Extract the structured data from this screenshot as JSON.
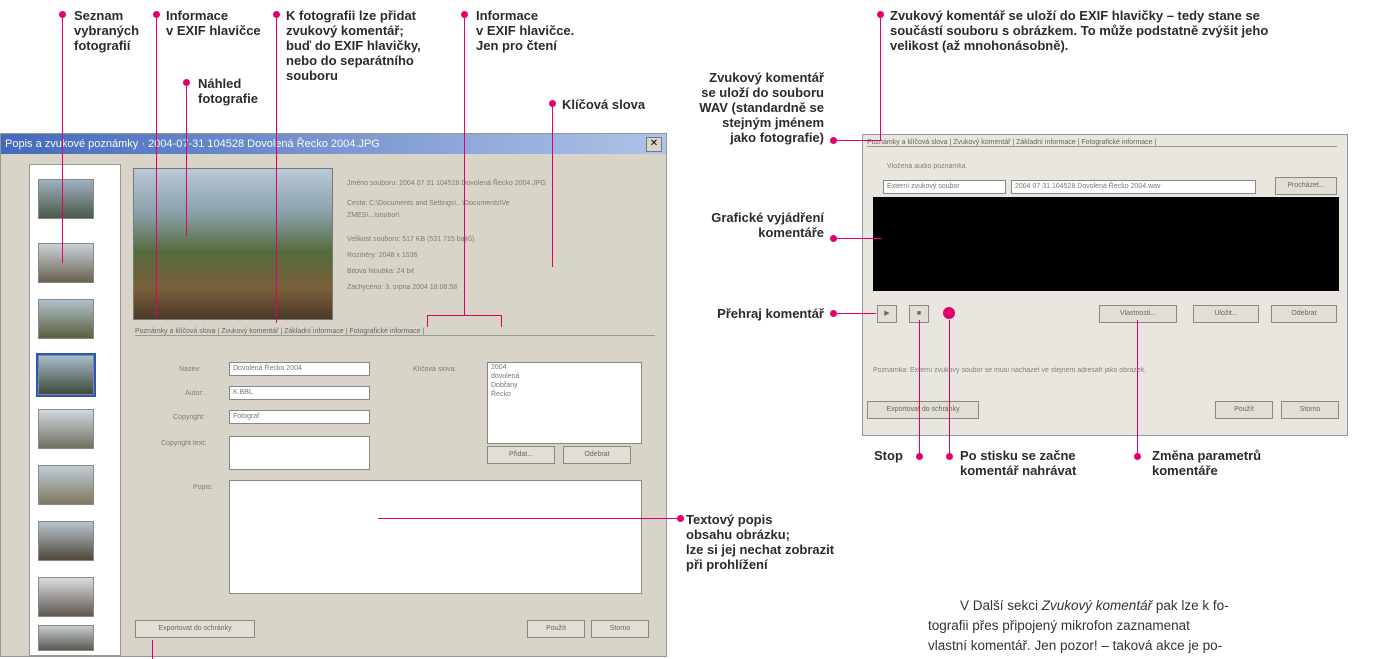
{
  "annotations": {
    "seznam": "Seznam\nvybraných\nfotografií",
    "exif_info": "Informace\nv EXIF hlavičce",
    "nahled": "Náhled\nfotografie",
    "zvukovy_pridat": "K fotografii lze přidat\nzvukový komentář;\nbuď do EXIF hlavičky,\nnebo do separátního\nsouboru",
    "exif_readonly": "Informace\nv EXIF hlavičce.\nJen pro čtení",
    "klicova_slova": "Klíčová slova",
    "textovy_popis": "Textový popis\nobsahu obrázku;\nlze si jej nechat zobrazit\npři prohlížení",
    "zvukovy_exif": "Zvukový komentář se uloží do EXIF hlavičky – tedy stane se\nsoučástí souboru s obrázkem. To může podstatně zvýšit jeho\nvelikost (až mnohonásobně).",
    "zvukovy_wav": "Zvukový komentář\nse uloží do souboru\nWAV (standardně se\nstejným jménem\njako fotografie)",
    "graficke": "Grafické vyjádření\nkomentáře",
    "prehraj": "Přehraj komentář",
    "stop": "Stop",
    "po_stisku": "Po stisku se začne\nkomentář nahrávat",
    "zmena": "Změna parametrů\nkomentáře"
  },
  "left_dialog": {
    "title": "Popis a zvukové poznámky · 2004-07-31 104528 Dovolená Řecko 2004.JPG",
    "close": "✕",
    "info_lines": [
      "Jméno souboru:   2004 07 31 104528 Dovolená Řecko 2004.JPG",
      "Cesta:   C:\\Documents and Settings\\...\\Documents\\Ve",
      "          ZMES\\...\\soubor\\",
      "Velikost souboru:   517 KB (531 715 bajtů)",
      "Rozměry:   2048 x 1536",
      "Bitová hloubka:   24 bit",
      "Zachyceno:   3. srpna 2004 18:08:58"
    ],
    "tabs": "Poznámky a klíčová slova | Zvukový komentář | Základní informace | Fotografické informace |",
    "labels": {
      "nazev": "Název:",
      "autor": "Autor:",
      "copyright": "Copyright:",
      "copyright_text": "Copyright text:",
      "popis": "Popis:",
      "klicova": "Klíčová slova:"
    },
    "values": {
      "nazev": "Dovolená Řecko 2004",
      "autor": "K.BBL",
      "copyright": "Fotograf"
    },
    "keywords": [
      "2004",
      "dovolená",
      "Dobřany",
      "Řecko"
    ],
    "btn_pridat": "Přidat...",
    "btn_odebrat": "Odebrat",
    "btn_export": "Exportovat do schránky",
    "btn_pouzit": "Použít",
    "btn_storno": "Storno"
  },
  "right_dialog": {
    "tabs": "Poznámky a klíčová slova | Zvukový komentář | Základní informace | Fotografické informace |",
    "radio_internal": "Vložená audio poznámka",
    "radio_external": "Externí zvukový soubor",
    "external_path": "2004 07 31 104528 Dovolená Řecko 2004.wav",
    "btn_prochazet": "Procházet...",
    "btn_vlastnosti": "Vlastnosti...",
    "btn_ulozit": "Uložit...",
    "btn_odebrat": "Odebrat",
    "note": "Poznámka: Externí zvukový soubor se musí nacházet ve stejném adresáři jako obrázek.",
    "btn_export": "Exportovat do schránky",
    "btn_pouzit": "Použít",
    "btn_storno": "Storno"
  },
  "article": {
    "line1_pre": "V Další sekci ",
    "line1_em": "Zvukový komentář",
    "line1_post": " pak lze k fo-",
    "line2": "tografii přes připojený mikrofon zaznamenat",
    "line3": "vlastní komentář. Jen pozor! – taková akce je po-"
  },
  "colors": {
    "accent": "#e4006c",
    "title_bar": "#2a58b8",
    "dialog_bg": "#d8d4c8"
  }
}
